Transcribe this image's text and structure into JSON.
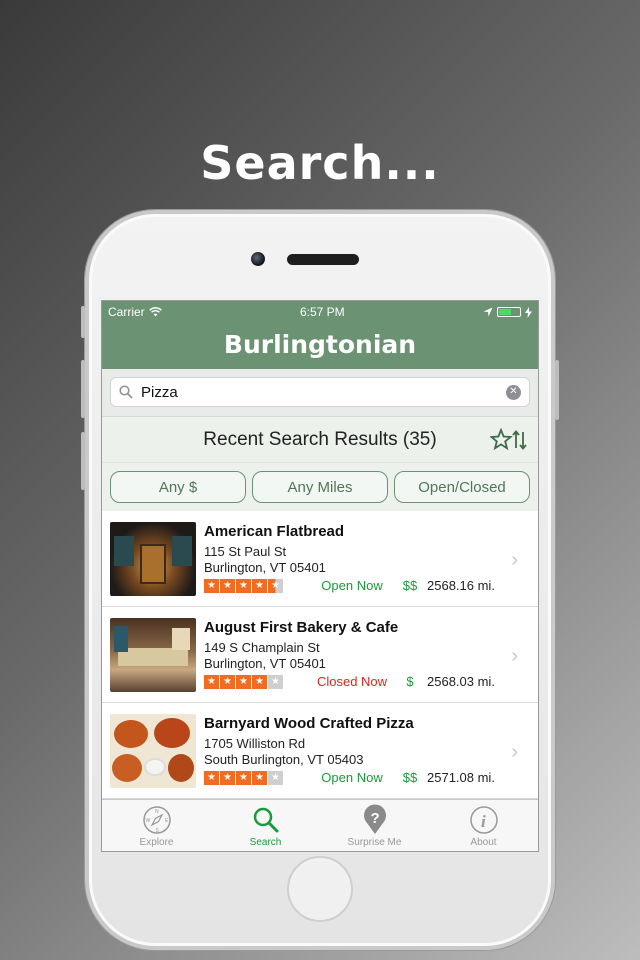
{
  "promo": {
    "headline": "Search..."
  },
  "status_bar": {
    "carrier": "Carrier",
    "time": "6:57 PM"
  },
  "nav": {
    "title": "Burlingtonian"
  },
  "search": {
    "value": "Pizza",
    "clear_glyph": "✕"
  },
  "results": {
    "title": "Recent Search Results (35)"
  },
  "filters": {
    "price": "Any $",
    "distance": "Any Miles",
    "open": "Open/Closed"
  },
  "items": [
    {
      "name": "American Flatbread",
      "address1": "115 St Paul St",
      "address2": "Burlington, VT 05401",
      "rating": 4.5,
      "status": "Open Now",
      "price": "$$",
      "distance": "2568.16 mi."
    },
    {
      "name": "August First Bakery & Cafe",
      "address1": "149 S Champlain St",
      "address2": "Burlington, VT 05401",
      "rating": 4,
      "status": "Closed Now",
      "price": "$",
      "distance": "2568.03 mi."
    },
    {
      "name": "Barnyard Wood Crafted Pizza",
      "address1": "1705 Williston Rd",
      "address2": "South Burlington, VT 05403",
      "rating": 4,
      "status": "Open Now",
      "price": "$$",
      "distance": "2571.08 mi."
    }
  ],
  "tabs": [
    {
      "label": "Explore",
      "icon": "compass-icon"
    },
    {
      "label": "Search",
      "icon": "search-icon"
    },
    {
      "label": "Surprise Me",
      "icon": "question-pin-icon"
    },
    {
      "label": "About",
      "icon": "info-icon"
    }
  ],
  "colors": {
    "nav_green": "#6a9273",
    "open_green": "#1a9a3a",
    "closed_red": "#e0231c",
    "star_orange": "#f26b21"
  }
}
